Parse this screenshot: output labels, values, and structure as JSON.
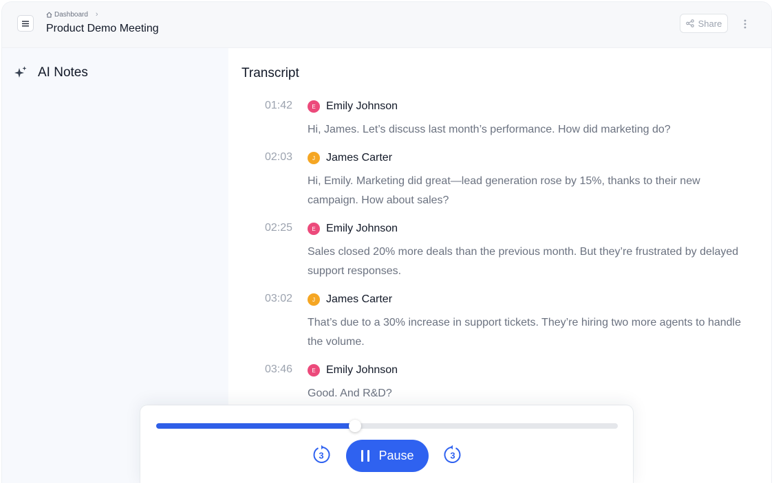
{
  "header": {
    "breadcrumb": "Dashboard",
    "title": "Product Demo Meeting",
    "share_label": "Share"
  },
  "sidebar": {
    "ai_notes_label": "AI Notes"
  },
  "transcript": {
    "title": "Transcript",
    "entries": [
      {
        "time": "01:42",
        "speaker": "Emily Johnson",
        "initial": "E",
        "color": "#ec4a7b",
        "text": "Hi, James. Let’s discuss last month’s performance. How did marketing do?"
      },
      {
        "time": "02:03",
        "speaker": "James Carter",
        "initial": "J",
        "color": "#f5a623",
        "text": "Hi, Emily. Marketing did great—lead generation rose by 15%, thanks to their new campaign. How about sales?"
      },
      {
        "time": "02:25",
        "speaker": "Emily Johnson",
        "initial": "E",
        "color": "#ec4a7b",
        "text": "Sales closed 20% more deals than the previous month. But they’re frustrated by delayed support responses."
      },
      {
        "time": "03:02",
        "speaker": "James Carter",
        "initial": "J",
        "color": "#f5a623",
        "text": "That’s due to a 30% increase in support tickets. They’re hiring two more agents to handle the volume."
      },
      {
        "time": "03:46",
        "speaker": "Emily Johnson",
        "initial": "E",
        "color": "#ec4a7b",
        "text": "Good. And R&D?"
      }
    ]
  },
  "player": {
    "progress": 0.43,
    "pause_label": "Pause",
    "rewind_seconds": "3",
    "forward_seconds": "3",
    "accent_color": "#2f62f0"
  }
}
